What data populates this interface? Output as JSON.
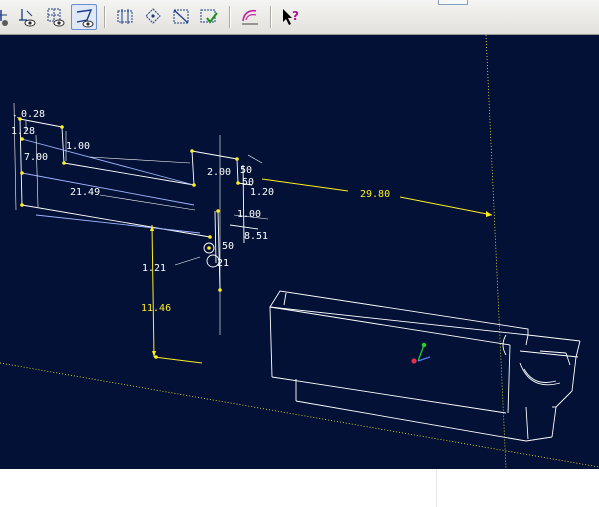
{
  "toolbar": {
    "buttons": [
      {
        "name": "dimension-display-icon"
      },
      {
        "name": "axis-display-icon"
      },
      {
        "name": "datum-display-icon"
      },
      {
        "name": "sketch-view-icon",
        "active": true
      },
      {
        "name": "constraint-display-icon"
      },
      {
        "name": "vertex-display-icon"
      },
      {
        "name": "grid-display-icon"
      },
      {
        "name": "check-sketch-icon"
      },
      {
        "name": "analysis-icon"
      },
      {
        "name": "context-help-icon"
      }
    ]
  },
  "sketch": {
    "dimensions": {
      "d_0_28": "0.28",
      "d_1_28": "1.28",
      "d_7_00": "7.00",
      "d_1_00_top": "1.00",
      "d_21_49": "21.49",
      "d_2_00": "2.00",
      "d_50_a": "50",
      "d_50_b": "50",
      "d_1_20": "1.20",
      "d_1_00_mid": "1.00",
      "d_8_51": "8.51",
      "d_50_c": "50",
      "d_1_21": "1.21",
      "d_21": "21",
      "d_29_80": "29.80",
      "d_11_46": "11.46"
    }
  },
  "colors": {
    "viewport_background": "#021135",
    "sketch_lines": "#ffffff",
    "highlight_dimensions": "#ffee22",
    "sketch_entity": "#9fb5ff"
  }
}
